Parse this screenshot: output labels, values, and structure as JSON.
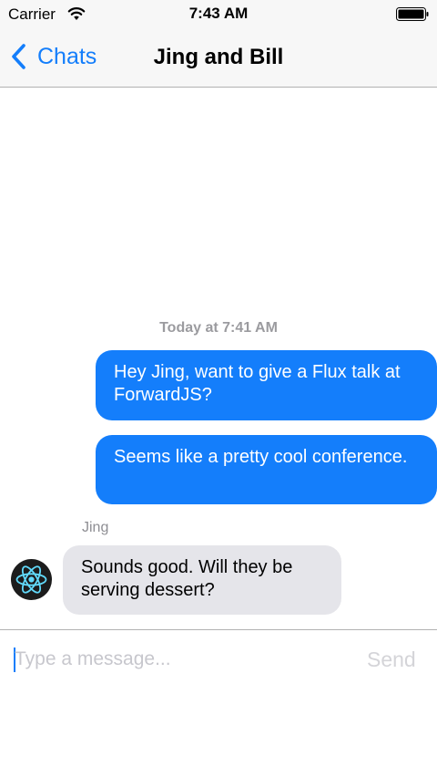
{
  "status_bar": {
    "carrier": "Carrier",
    "time": "7:43 AM",
    "icons": [
      "wifi-icon",
      "battery-icon"
    ]
  },
  "nav": {
    "back_label": "Chats",
    "back_icon": "chevron-left-icon",
    "title": "Jing and Bill"
  },
  "conversation": {
    "timestamp": "Today at 7:41 AM",
    "messages": [
      {
        "direction": "outgoing",
        "text": "Hey Jing, want to give a Flux talk at ForwardJS?"
      },
      {
        "direction": "outgoing",
        "text": "Seems like a pretty cool conference."
      },
      {
        "direction": "incoming",
        "sender": "Jing",
        "avatar_icon": "react-logo-icon",
        "text": "Sounds good.  Will they be serving dessert?"
      }
    ]
  },
  "composer": {
    "placeholder": "Type a message...",
    "value": "",
    "send_label": "Send"
  },
  "colors": {
    "accent": "#147efb",
    "outgoing_bubble": "#147efb",
    "incoming_bubble": "#e5e5ea",
    "bar_background": "#f7f7f7",
    "secondary_text": "#9b9b9f"
  }
}
